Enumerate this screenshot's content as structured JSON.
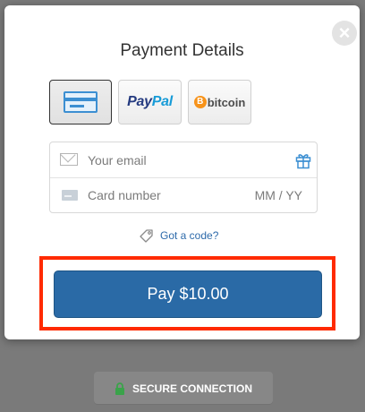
{
  "modal": {
    "title": "Payment Details",
    "close_icon": "close-icon"
  },
  "payment_methods": [
    {
      "name": "card",
      "icon": "credit-card-icon",
      "selected": true
    },
    {
      "name": "paypal",
      "logo_pay": "Pay",
      "logo_pal": "Pal"
    },
    {
      "name": "bitcoin",
      "coin_glyph": "B",
      "logo_text": "bitcoin"
    }
  ],
  "form": {
    "email_placeholder": "Your email",
    "card_placeholder": "Card number",
    "expiry_placeholder": "MM / YY",
    "email_icon": "envelope-icon",
    "gift_icon": "gift-icon",
    "card_icon": "card-icon"
  },
  "code_link": {
    "label": "Got a code?",
    "icon": "tag-icon"
  },
  "pay_button": {
    "label": "Pay $10.00"
  },
  "secure_badge": {
    "label": "SECURE CONNECTION",
    "icon": "lock-icon"
  },
  "colors": {
    "accent": "#2a6aa6",
    "highlight": "#ff2a00",
    "lock": "#3aa34a",
    "link": "#2d6aaa"
  }
}
